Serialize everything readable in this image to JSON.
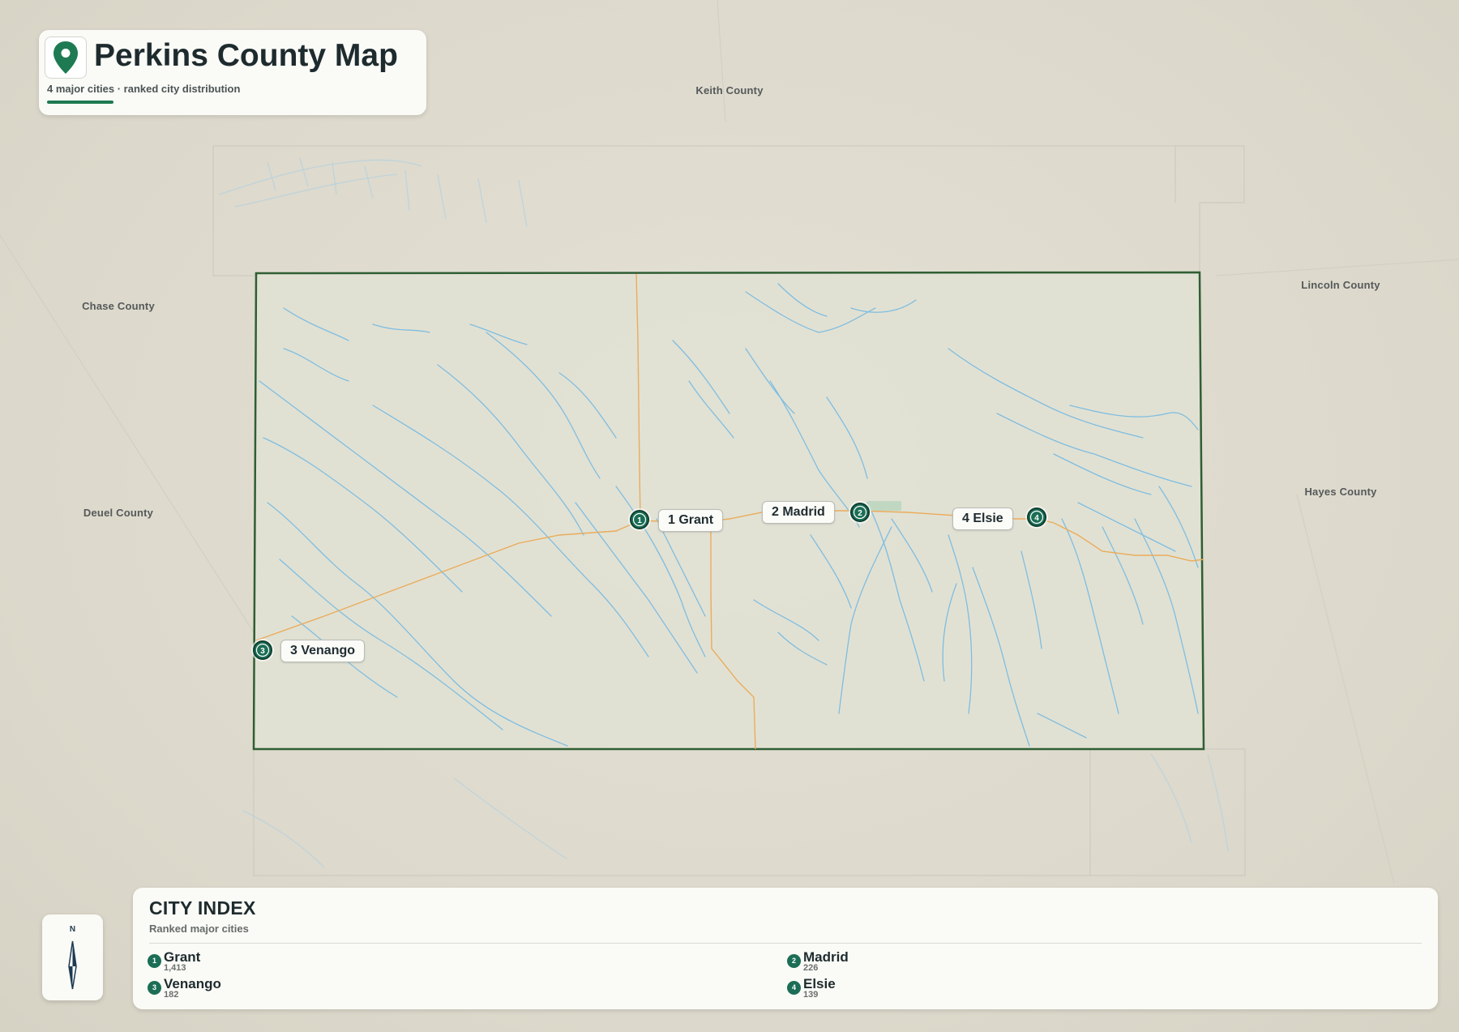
{
  "title": {
    "heading": "Perkins County Map",
    "subtitle": "4 major cities · ranked city distribution",
    "icon": "map-pin-icon"
  },
  "neighbors": {
    "north": "Keith County",
    "northwest": "Chase County",
    "west": "Deuel County",
    "northeast": "Lincoln County",
    "east": "Hayes County"
  },
  "cities": [
    {
      "rank": "1",
      "name": "Grant",
      "label": "1 Grant",
      "population": "1,413"
    },
    {
      "rank": "2",
      "name": "Madrid",
      "label": "2 Madrid",
      "population": "226"
    },
    {
      "rank": "3",
      "name": "Venango",
      "label": "3 Venango",
      "population": "182"
    },
    {
      "rank": "4",
      "name": "Elsie",
      "label": "4 Elsie",
      "population": "139"
    }
  ],
  "city_index": {
    "title": "CITY INDEX",
    "subtitle": "Ranked major cities"
  },
  "compass": {
    "north_label": "N",
    "icon": "north-arrow-icon"
  },
  "colors": {
    "county_border": "#2f5e33",
    "county_fill": "#e1e2d3",
    "rivers": "#7fbde0",
    "roads": "#eaac5c",
    "marker": "#1b6e55",
    "accent": "#1e7a52"
  }
}
